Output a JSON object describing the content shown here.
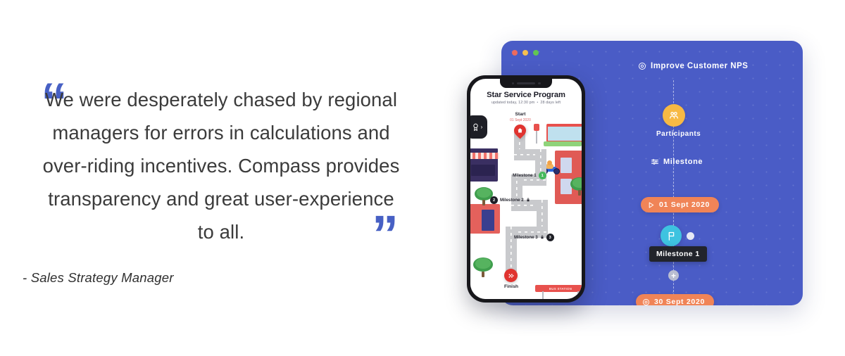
{
  "testimonial": {
    "open_quote": "“",
    "close_quote": "”",
    "text": "We were desperately chased by regional managers for errors in calculations and over-riding incentives. Compass provides transparency and great user-experience to all.",
    "attribution": "- Sales Strategy Manager",
    "accent_color": "#4760c4",
    "text_color": "#3b3b3b"
  },
  "app_card": {
    "background_color": "#4a5cc6",
    "window_dots": [
      {
        "name": "close",
        "color": "#ed6a5e"
      },
      {
        "name": "minimize",
        "color": "#f5bf4f"
      },
      {
        "name": "maximize",
        "color": "#61c554"
      }
    ],
    "goal": {
      "icon": "target-icon",
      "label": "Improve Customer NPS"
    },
    "participants": {
      "icon": "people-icon",
      "label": "Participants",
      "color": "#f7b944"
    },
    "milestone_header": {
      "icon": "sliders-icon",
      "label": "Milestone"
    },
    "start_pill": {
      "icon": "play-icon",
      "label": "01 Sept 2020",
      "color": "#f08457"
    },
    "end_pill": {
      "icon": "target-icon",
      "label": "30 Sept 2020",
      "color": "#f08457"
    },
    "milestone_node": {
      "icon": "flag-icon",
      "tooltip": "Milestone 1",
      "color": "#3ec3e0"
    },
    "add_node": {
      "icon": "plus-icon",
      "label": "+"
    }
  },
  "phone": {
    "app_title": "Star Service Program",
    "subtitle_updated": "updated today, 12:30 pm",
    "subtitle_separator": "•",
    "subtitle_days_left": "28 days left",
    "badge_tab": {
      "icon": "award-badge-icon",
      "chevron": "›"
    },
    "map": {
      "start_label": "Start",
      "start_date": "01 Sept 2020",
      "finish_label": "Finish",
      "milestones": [
        {
          "label": "Milestone 1",
          "number": "1",
          "locked": false,
          "chip_color": "#46b95c"
        },
        {
          "label": "Milestone 2",
          "number": "2",
          "locked": true,
          "chip_color": "#1e1f26"
        },
        {
          "label": "Milestone 3",
          "number": "3",
          "locked": true,
          "chip_color": "#1e1f26"
        }
      ],
      "lock_glyph": "🔒",
      "bus_stop_label": "BUS STATION"
    }
  }
}
